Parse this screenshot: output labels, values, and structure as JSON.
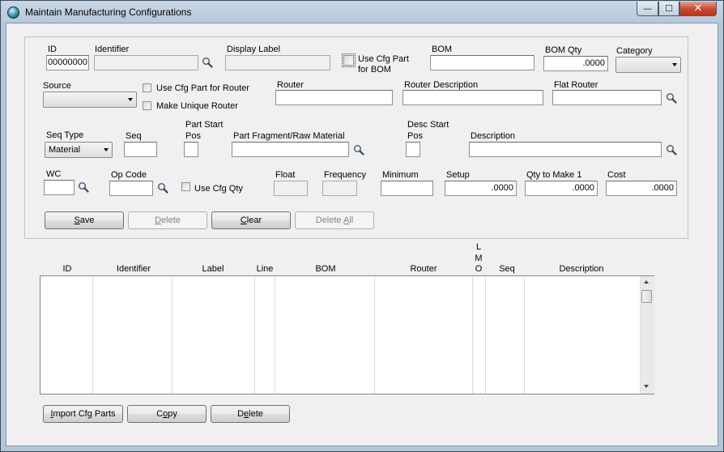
{
  "window": {
    "title": "Maintain Manufacturing Configurations",
    "minimize": "—",
    "maximize": "☐",
    "close": "✕"
  },
  "form": {
    "id": {
      "label": "ID",
      "value": "00000000"
    },
    "identifier": {
      "label": "Identifier",
      "value": ""
    },
    "display_label": {
      "label": "Display Label",
      "value": ""
    },
    "use_cfg_part_bom": {
      "label_line1": "Use Cfg Part",
      "label_line2": "for BOM",
      "checked": false
    },
    "bom": {
      "label": "BOM",
      "value": ""
    },
    "bom_qty": {
      "label": "BOM Qty",
      "value": ".0000"
    },
    "category": {
      "label": "Category",
      "value": ""
    },
    "source": {
      "label": "Source",
      "value": ""
    },
    "use_cfg_part_router": {
      "label": "Use Cfg Part for Router",
      "checked": false
    },
    "make_unique_router": {
      "label": "Make Unique Router",
      "checked": false
    },
    "router": {
      "label": "Router",
      "value": ""
    },
    "router_description": {
      "label": "Router Description",
      "value": ""
    },
    "flat_router": {
      "label": "Flat Router",
      "value": ""
    },
    "seq_type": {
      "label": "Seq Type",
      "value": "Material"
    },
    "seq": {
      "label": "Seq",
      "value": ""
    },
    "part_start_pos": {
      "label_line1": "Part Start",
      "label_line2": "Pos",
      "value": ""
    },
    "part_fragment": {
      "label": "Part Fragment/Raw Material",
      "value": ""
    },
    "desc_start_pos": {
      "label_line1": "Desc Start",
      "label_line2": "Pos",
      "value": ""
    },
    "description": {
      "label": "Description",
      "value": ""
    },
    "wc": {
      "label": "WC",
      "value": ""
    },
    "op_code": {
      "label": "Op Code",
      "value": ""
    },
    "use_cfg_qty": {
      "label": "Use Cfg Qty",
      "checked": false
    },
    "float": {
      "label": "Float",
      "value": ""
    },
    "frequency": {
      "label": "Frequency",
      "value": ""
    },
    "minimum": {
      "label": "Minimum",
      "value": ""
    },
    "setup": {
      "label": "Setup",
      "value": ".0000"
    },
    "qty_to_make": {
      "label": "Qty to Make 1",
      "value": ".0000"
    },
    "cost": {
      "label": "Cost",
      "value": ".0000"
    }
  },
  "form_buttons": {
    "save": {
      "pre": "",
      "key": "S",
      "post": "ave",
      "enabled": true
    },
    "delete": {
      "pre": "",
      "key": "D",
      "post": "elete",
      "enabled": false
    },
    "clear": {
      "pre": "",
      "key": "C",
      "post": "lear",
      "enabled": true
    },
    "delete_all": {
      "pre": "Delete ",
      "key": "A",
      "post": "ll",
      "enabled": false
    }
  },
  "grid": {
    "columns": [
      "ID",
      "Identifier",
      "Label",
      "Line",
      "BOM",
      "Router",
      "L\nM\nO",
      "Seq",
      "Description"
    ],
    "rows": []
  },
  "bottom_buttons": {
    "import": {
      "pre": "",
      "key": "I",
      "post": "mport Cfg Parts"
    },
    "copy": {
      "pre": "C",
      "key": "o",
      "post": "py"
    },
    "delete": {
      "pre": "D",
      "key": "e",
      "post": "lete"
    }
  },
  "icons": {
    "search": "magnifier-icon",
    "dropdown": "chevron-down-icon",
    "app": "app-globe-icon"
  },
  "colors": {
    "title_bar": "#b4c6d9",
    "close_button": "#c8472b",
    "form_background": "#f0f0f0"
  }
}
